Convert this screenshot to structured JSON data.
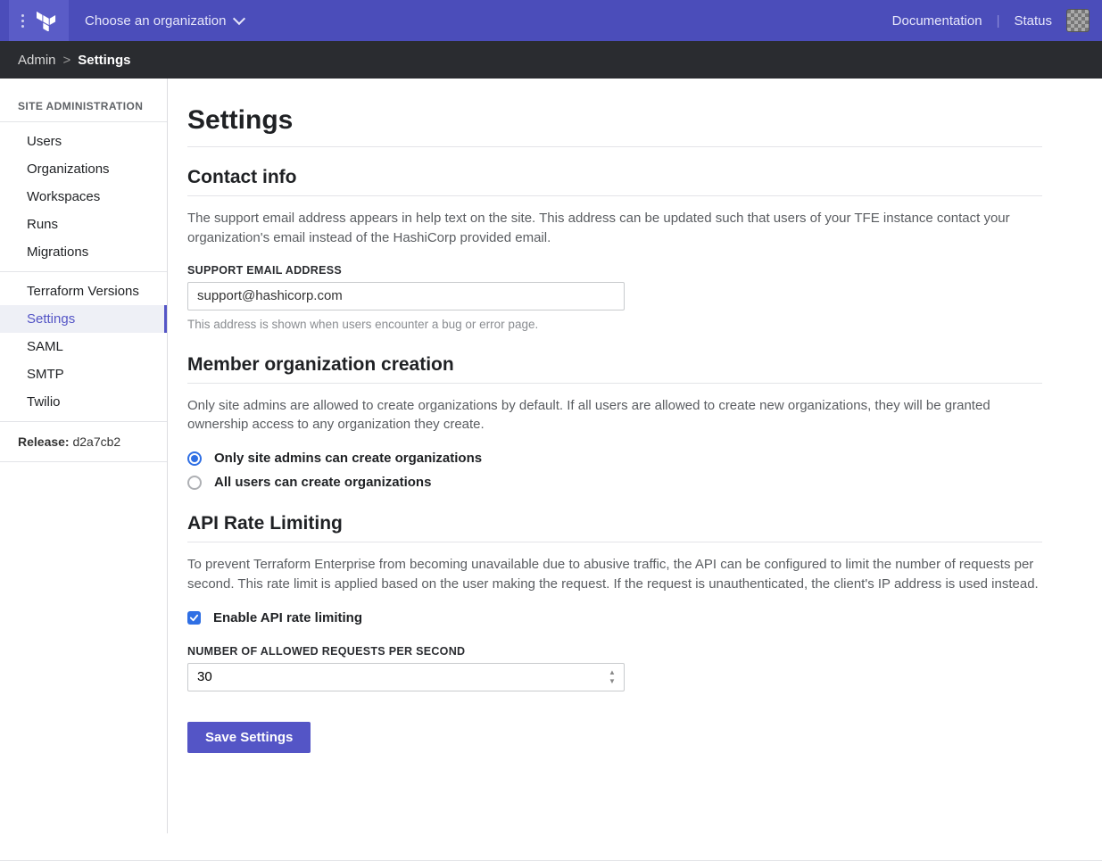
{
  "topbar": {
    "org_picker_label": "Choose an organization",
    "links": {
      "documentation": "Documentation",
      "status": "Status"
    }
  },
  "breadcrumb": {
    "root": "Admin",
    "current": "Settings"
  },
  "sidebar": {
    "heading": "SITE ADMINISTRATION",
    "group1": [
      {
        "label": "Users"
      },
      {
        "label": "Organizations"
      },
      {
        "label": "Workspaces"
      },
      {
        "label": "Runs"
      },
      {
        "label": "Migrations"
      }
    ],
    "group2": [
      {
        "label": "Terraform Versions"
      },
      {
        "label": "Settings",
        "active": true
      },
      {
        "label": "SAML"
      },
      {
        "label": "SMTP"
      },
      {
        "label": "Twilio"
      }
    ],
    "release_label": "Release:",
    "release_value": "d2a7cb2"
  },
  "page": {
    "title": "Settings",
    "contact": {
      "heading": "Contact info",
      "description": "The support email address appears in help text on the site. This address can be updated such that users of your TFE instance contact your organization's email instead of the HashiCorp provided email.",
      "field_label": "SUPPORT EMAIL ADDRESS",
      "field_value": "support@hashicorp.com",
      "help": "This address is shown when users encounter a bug or error page."
    },
    "member_org": {
      "heading": "Member organization creation",
      "description": "Only site admins are allowed to create organizations by default. If all users are allowed to create new organizations, they will be granted ownership access to any organization they create.",
      "option1": "Only site admins can create organizations",
      "option2": "All users can create organizations",
      "selected": "option1"
    },
    "rate_limit": {
      "heading": "API Rate Limiting",
      "description": "To prevent Terraform Enterprise from becoming unavailable due to abusive traffic, the API can be configured to limit the number of requests per second. This rate limit is applied based on the user making the request. If the request is unauthenticated, the client's IP address is used instead.",
      "enable_label": "Enable API rate limiting",
      "enabled": true,
      "field_label": "NUMBER OF ALLOWED REQUESTS PER SECOND",
      "field_value": "30"
    },
    "save_button": "Save Settings"
  }
}
